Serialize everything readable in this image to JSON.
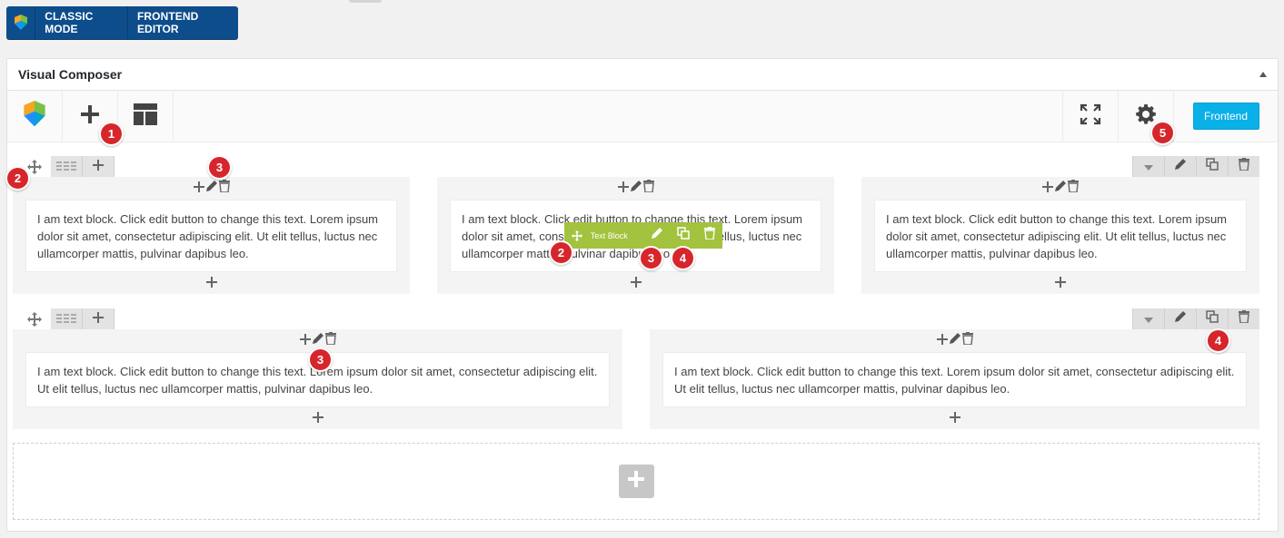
{
  "mode_bar": {
    "classic_label": "CLASSIC MODE",
    "frontend_editor_label": "FRONTEND EDITOR"
  },
  "panel": {
    "title": "Visual Composer"
  },
  "toolbar": {
    "frontend_label": "Frontend"
  },
  "text_block": {
    "content": "I am text block. Click edit button to change this text. Lorem ipsum dolor sit amet, consectetur adipiscing elit. Ut elit tellus, luctus nec ullamcorper mattis, pulvinar dapibus leo."
  },
  "element_toolbar": {
    "label": "Text Block"
  },
  "badges": {
    "b1": "1",
    "b2": "2",
    "b3": "3",
    "b4": "4",
    "b5": "5"
  },
  "colors": {
    "brand_blue": "#0e4d8b",
    "frontend_button": "#0ab0e8",
    "element_toolbar": "#a3c23e",
    "badge": "#d6262c"
  },
  "icons": [
    "vc-logo-icon",
    "plus-icon",
    "layout-template-icon",
    "fullscreen-icon",
    "gear-icon",
    "move-icon",
    "columns-icon",
    "chevron-down-icon",
    "pencil-icon",
    "clone-icon",
    "trash-icon",
    "collapse-arrow-icon"
  ]
}
